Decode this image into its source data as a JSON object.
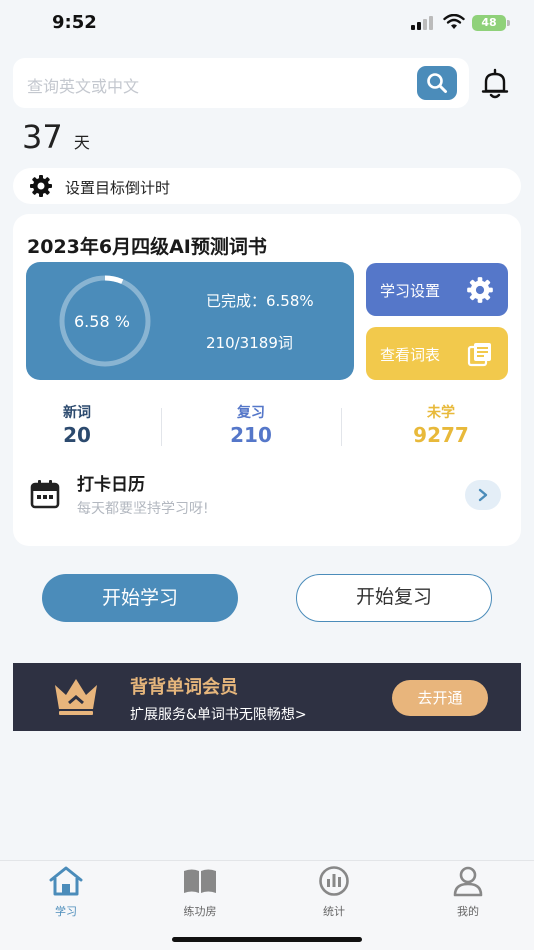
{
  "status_bar": {
    "time": "9:52",
    "battery": "48"
  },
  "search": {
    "placeholder": "查询英文或中文"
  },
  "countdown": {
    "number": "37",
    "unit": "天"
  },
  "goal": {
    "label": "设置目标倒计时"
  },
  "book": {
    "title": "2023年6月四级AI预测词书",
    "progress_percent_label": "6.58 %",
    "progress_fraction": 0.0658,
    "completed_label": "已完成：6.58%",
    "count_label": "210/3189词"
  },
  "side_buttons": {
    "settings": "学习设置",
    "wordlist": "查看词表"
  },
  "stats": [
    {
      "label": "新词",
      "value": "20",
      "color": "#2c4a6e"
    },
    {
      "label": "复习",
      "value": "210",
      "color": "#5577c9"
    },
    {
      "label": "未学",
      "value": "9277",
      "color": "#e8b93a"
    }
  ],
  "calendar": {
    "title": "打卡日历",
    "subtitle": "每天都要坚持学习呀!"
  },
  "actions": {
    "start_learn": "开始学习",
    "start_review": "开始复习"
  },
  "vip": {
    "title": "背背单词会员",
    "subtitle": "扩展服务&单词书无限畅想>",
    "button": "去开通"
  },
  "tabs": [
    {
      "label": "学习",
      "icon": "home-icon",
      "active": true
    },
    {
      "label": "练功房",
      "icon": "book-icon",
      "active": false
    },
    {
      "label": "统计",
      "icon": "chart-icon",
      "active": false
    },
    {
      "label": "我的",
      "icon": "user-icon",
      "active": false
    }
  ],
  "colors": {
    "accent": "#4b8cba",
    "settings_button": "#5577c9",
    "wordlist_button": "#f2c94c",
    "vip_gold": "#e8b57c"
  }
}
